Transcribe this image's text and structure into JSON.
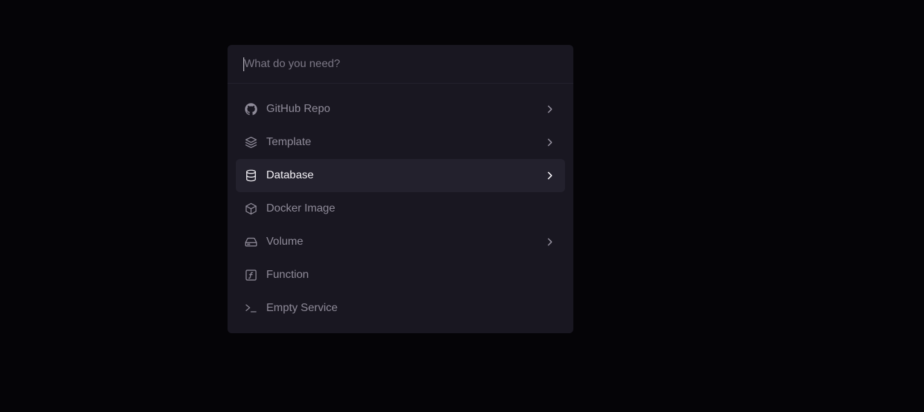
{
  "search": {
    "placeholder": "What do you need?",
    "value": ""
  },
  "items": [
    {
      "label": "GitHub Repo",
      "icon": "github-icon",
      "has_submenu": true,
      "active": false
    },
    {
      "label": "Template",
      "icon": "layers-icon",
      "has_submenu": true,
      "active": false
    },
    {
      "label": "Database",
      "icon": "database-icon",
      "has_submenu": true,
      "active": true
    },
    {
      "label": "Docker Image",
      "icon": "box-icon",
      "has_submenu": false,
      "active": false
    },
    {
      "label": "Volume",
      "icon": "hard-drive-icon",
      "has_submenu": true,
      "active": false
    },
    {
      "label": "Function",
      "icon": "function-icon",
      "has_submenu": false,
      "active": false
    },
    {
      "label": "Empty Service",
      "icon": "terminal-icon",
      "has_submenu": false,
      "active": false
    }
  ],
  "colors": {
    "background": "#050407",
    "panel": "#191721",
    "active_row": "#23212d",
    "text_muted": "#8f8b99",
    "text_active": "#f4f2f7"
  }
}
